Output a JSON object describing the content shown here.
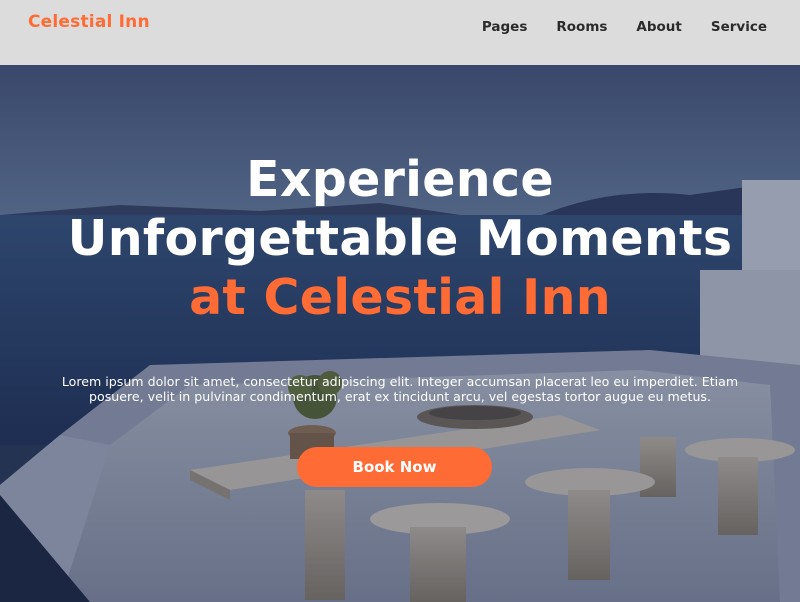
{
  "brand": {
    "name": "Celestial Inn",
    "accent_color": "#ff6b35"
  },
  "nav": {
    "items": [
      {
        "label": "Pages"
      },
      {
        "label": "Rooms"
      },
      {
        "label": "About"
      },
      {
        "label": "Service"
      }
    ]
  },
  "hero": {
    "title_line1": "Experience",
    "title_line2": "Unforgettable Moments",
    "title_line3": "at Celestial Inn",
    "description": "Lorem ipsum dolor sit amet, consectetur adipiscing elit. Integer accumsan placerat leo eu imperdiet. Etiam posuere, velit in pulvinar condimentum, erat ex tincidunt arcu, vel egestas tortor augue eu metus.",
    "cta_label": "Book Now"
  }
}
